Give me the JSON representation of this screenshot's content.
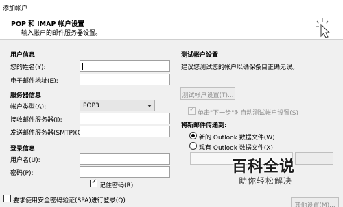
{
  "window": {
    "title": "添加帐户"
  },
  "header": {
    "title": "POP 和 IMAP 帐户设置",
    "subtitle": "输入帐户的邮件服务器设置。"
  },
  "left": {
    "user_info": {
      "section": "用户信息",
      "name_label": "您的姓名(Y):",
      "email_label": "电子邮件地址(E):"
    },
    "server_info": {
      "section": "服务器信息",
      "account_type_label": "帐户类型(A):",
      "account_type_value": "POP3",
      "incoming_label": "接收邮件服务器(I):",
      "outgoing_label": "发送邮件服务器(SMTP)(O):"
    },
    "login_info": {
      "section": "登录信息",
      "username_label": "用户名(U):",
      "password_label": "密码(P):",
      "remember_password_label": "记住密码(R)",
      "remember_password_checked": true,
      "spa_label": "要求使用安全密码验证(SPA)进行登录(Q)",
      "spa_checked": false
    }
  },
  "right": {
    "test": {
      "section": "测试帐户设置",
      "description": "建议您测试您的帐户以确保条目正确无误。",
      "test_button": "测试帐户设置(T)...",
      "auto_test_label": "单击\"下一步\"时自动测试帐户设置(S)",
      "auto_test_checked": true
    },
    "deliver": {
      "section": "将新邮件传递到:",
      "new_option": "新的 Outlook 数据文件(W)",
      "existing_option": "现有 Outlook 数据文件(X)",
      "selected": "new"
    },
    "more_settings_button": "其他设置(M)..."
  },
  "watermark": {
    "logo": "百科全说",
    "sub": "助你轻松解决"
  }
}
